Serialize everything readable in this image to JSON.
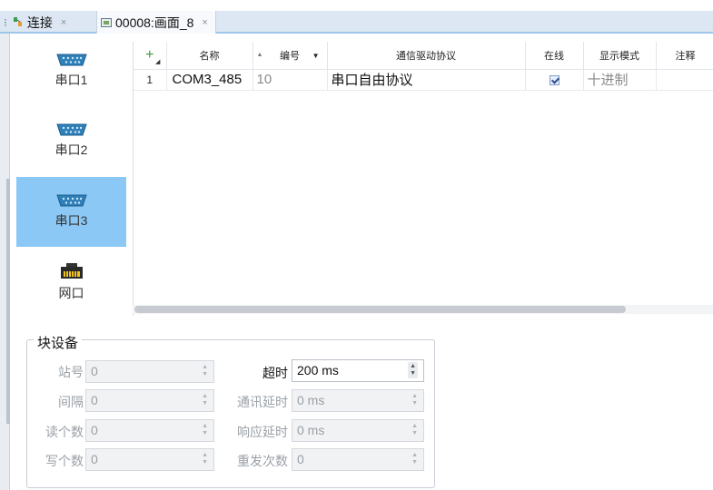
{
  "tabs": [
    {
      "label": "连接",
      "close": "×"
    },
    {
      "label": "00008:画面_8",
      "close": "×"
    }
  ],
  "sidebar": {
    "ports": [
      {
        "label": "串口1",
        "icon": "serial-port-icon",
        "selected": false
      },
      {
        "label": "串口2",
        "icon": "serial-port-icon",
        "selected": false
      },
      {
        "label": "串口3",
        "icon": "serial-port-icon",
        "selected": true
      },
      {
        "label": "网口",
        "icon": "ethernet-port-icon",
        "selected": false
      }
    ]
  },
  "table": {
    "add_label": "+",
    "columns": [
      "名称",
      "编号",
      "通信驱动协议",
      "在线",
      "显示模式",
      "注释"
    ],
    "rows": [
      {
        "index": "1",
        "name": "COM3_485",
        "number": "10",
        "protocol": "串口自由协议",
        "online": true,
        "mode": "十进制",
        "note": ""
      }
    ]
  },
  "block_device": {
    "title": "块设备",
    "station_label": "站号",
    "station_value": "0",
    "interval_label": "间隔",
    "interval_value": "0",
    "read_count_label": "读个数",
    "read_count_value": "0",
    "write_count_label": "写个数",
    "write_count_value": "0",
    "timeout_label": "超时",
    "timeout_value": "200 ms",
    "comm_delay_label": "通讯延时",
    "comm_delay_value": "0 ms",
    "response_delay_label": "响应延时",
    "response_delay_value": "0 ms",
    "retry_label": "重发次数",
    "retry_value": "0"
  },
  "colors": {
    "selected_port": "#8cc8f6",
    "tab_strip": "#dde7f3",
    "add_icon": "#3b9b3b"
  }
}
